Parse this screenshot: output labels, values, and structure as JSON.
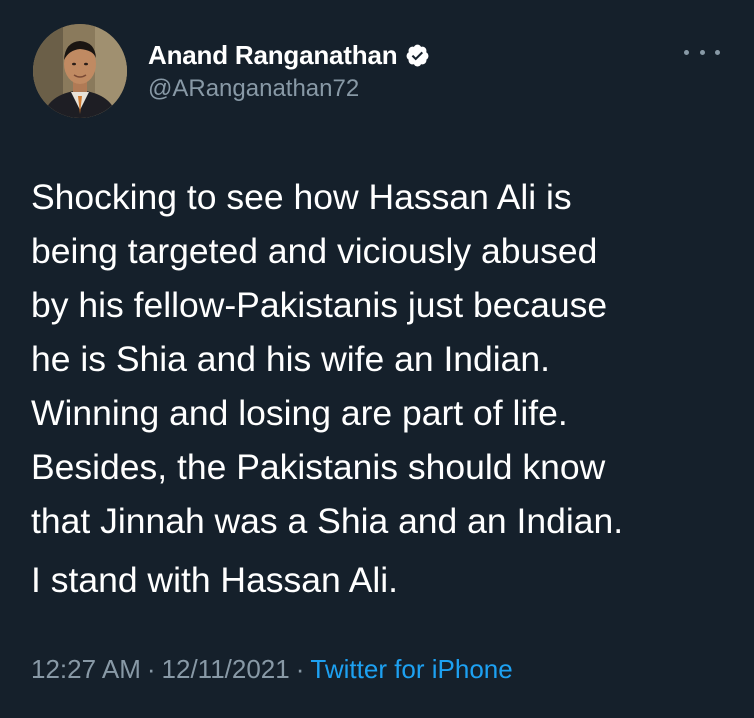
{
  "author": {
    "display_name": "Anand Ranganathan",
    "handle": "@ARanganathan72",
    "verified_icon": "verified-badge-icon"
  },
  "tweet": {
    "lines": [
      "Shocking to see how Hassan Ali is",
      "being targeted and viciously abused",
      "by his fellow-Pakistanis just because",
      "he is Shia and his wife an Indian.",
      "Winning and losing are part of life.",
      "Besides, the Pakistanis should know",
      "that Jinnah was a Shia and an Indian."
    ],
    "second_paragraph": "I stand with Hassan Ali."
  },
  "meta": {
    "time": "12:27 AM",
    "separator": "·",
    "date": "12/11/2021",
    "source": "Twitter for iPhone"
  },
  "colors": {
    "background": "#15202b",
    "primary_text": "#ffffff",
    "secondary_text": "#8899a6",
    "accent": "#1da1f2"
  }
}
